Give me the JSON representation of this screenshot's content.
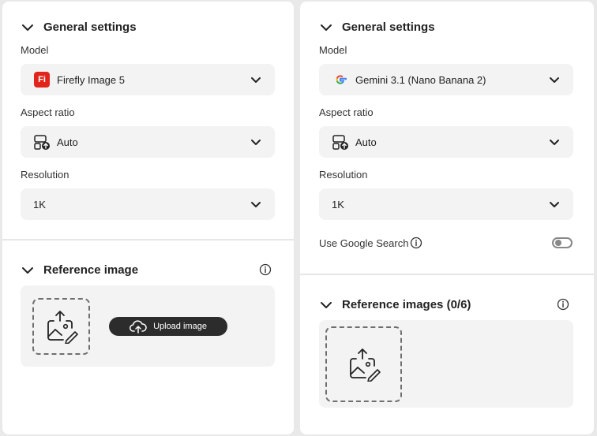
{
  "left": {
    "general_title": "General settings",
    "model_label": "Model",
    "model_value": "Firefly Image 5",
    "model_logo_text": "Fi",
    "aspect_label": "Aspect ratio",
    "aspect_value": "Auto",
    "resolution_label": "Resolution",
    "resolution_value": "1K",
    "reference_title": "Reference image",
    "upload_label": "Upload image"
  },
  "right": {
    "general_title": "General settings",
    "model_label": "Model",
    "model_value": "Gemini 3.1 (Nano Banana 2)",
    "aspect_label": "Aspect ratio",
    "aspect_value": "Auto",
    "resolution_label": "Resolution",
    "resolution_value": "1K",
    "google_search_label": "Use Google Search",
    "google_search_enabled": false,
    "reference_title": "Reference images (0/6)"
  },
  "icons": {
    "section_toggle": "chevron-down-icon",
    "dropdown": "chevron-down-icon",
    "aspect": "aspect-ratio-icon",
    "info": "info-icon",
    "image_upload": "image-upload-icon",
    "cloud_upload": "cloud-upload-icon",
    "google": "google-logo-icon",
    "firefly": "firefly-logo-icon"
  },
  "colors": {
    "firefly_red": "#e1251b",
    "upload_button_bg": "#2c2c2c",
    "dropdown_bg": "#f3f3f3"
  }
}
